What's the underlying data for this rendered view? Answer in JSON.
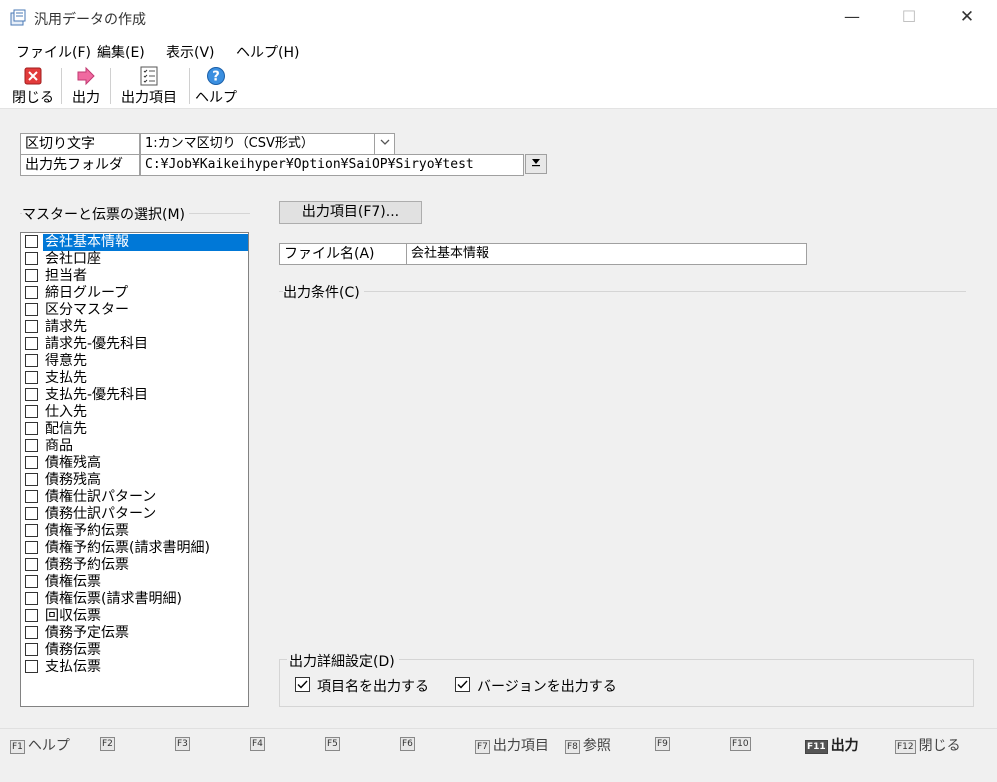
{
  "window": {
    "title": "汎用データの作成"
  },
  "window_controls": {
    "minimize": "—",
    "maximize": "☐",
    "close": "✕"
  },
  "menu": [
    "ファイル(F)",
    "編集(E)",
    "表示(V)",
    "ヘルプ(H)"
  ],
  "toolbar": {
    "close": "閉じる",
    "output": "出力",
    "output_items": "出力項目",
    "help": "ヘルプ"
  },
  "form": {
    "delimiter_label": "区切り文字",
    "delimiter_value": "1:カンマ区切り（CSV形式）",
    "folder_label": "出力先フォルダ",
    "folder_value": "C:¥Job¥Kaikeihyper¥Option¥SaiOP¥Siryo¥test"
  },
  "master_section": {
    "label": "マスターと伝票の選択(M)"
  },
  "master_list": [
    "会社基本情報",
    "会社口座",
    "担当者",
    "締日グループ",
    "区分マスター",
    "請求先",
    "請求先-優先科目",
    "得意先",
    "支払先",
    "支払先-優先科目",
    "仕入先",
    "配信先",
    "商品",
    "債権残高",
    "債務残高",
    "債権仕訳パターン",
    "債務仕訳パターン",
    "債権予約伝票",
    "債権予約伝票(請求書明細)",
    "債務予約伝票",
    "債権伝票",
    "債権伝票(請求書明細)",
    "回収伝票",
    "債務予定伝票",
    "債務伝票",
    "支払伝票"
  ],
  "output_items_button": "出力項目(F7)...",
  "filename": {
    "label": "ファイル名(A)",
    "value": "会社基本情報"
  },
  "output_condition_label": "出力条件(C)",
  "detail_settings": {
    "label": "出力詳細設定(D)",
    "item_names": "項目名を出力する",
    "version": "バージョンを出力する"
  },
  "fkeys": {
    "f1": "F1",
    "f1_label": "ヘルプ",
    "f2": "F2",
    "f3": "F3",
    "f4": "F4",
    "f5": "F5",
    "f6": "F6",
    "f7": "F7",
    "f7_label": "出力項目",
    "f8": "F8",
    "f8_label": "参照",
    "f9": "F9",
    "f10": "F10",
    "f11": "F11",
    "f11_label": "出力",
    "f12": "F12",
    "f12_label": "閉じる"
  }
}
